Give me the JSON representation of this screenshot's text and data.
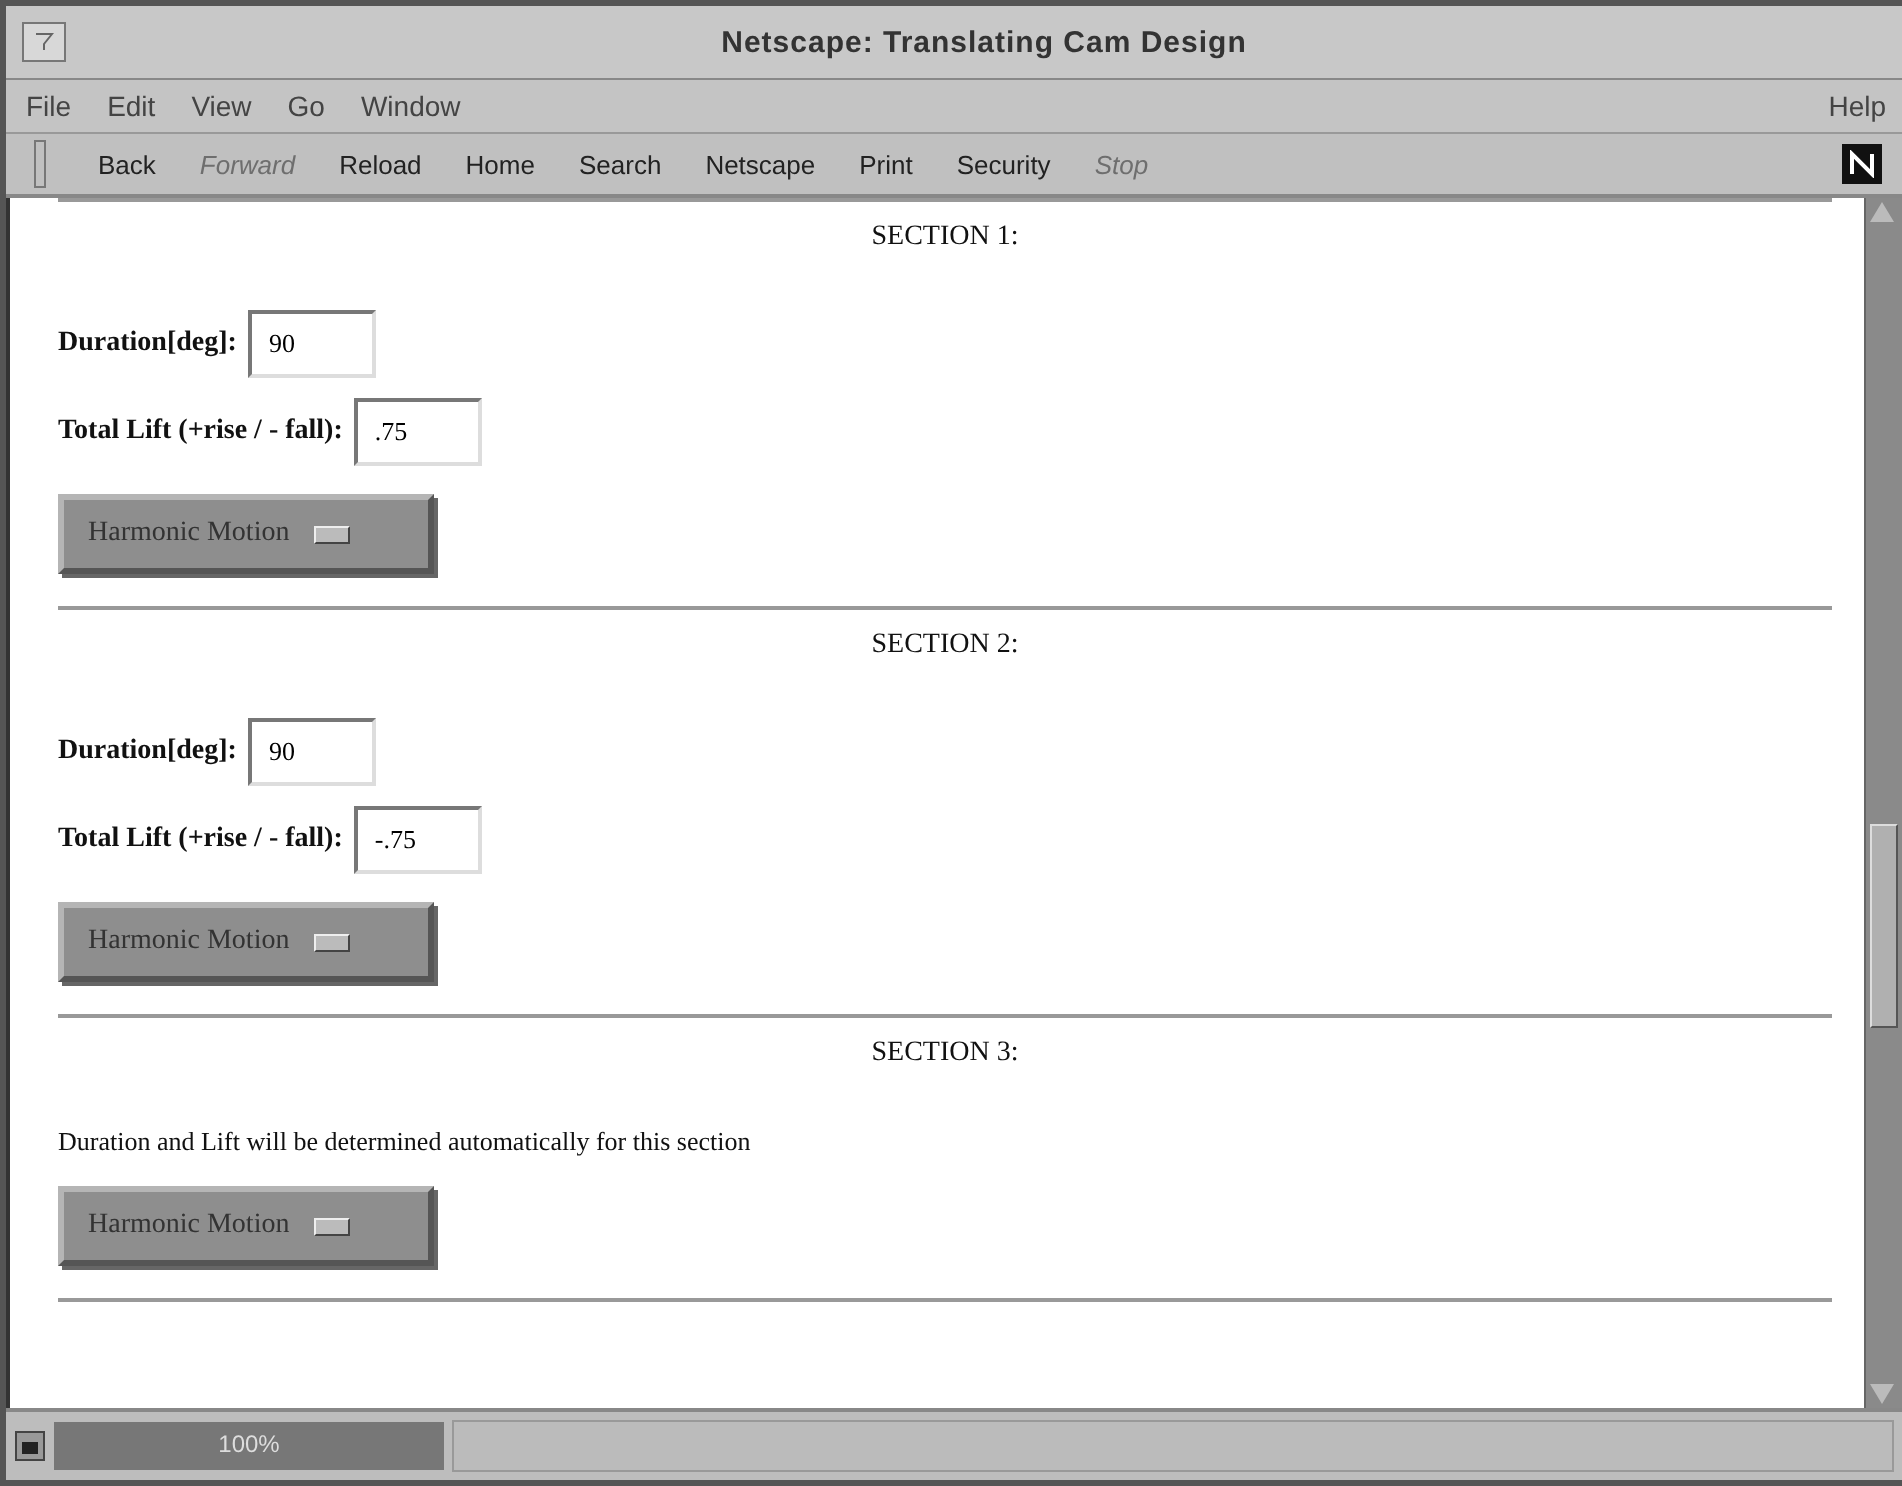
{
  "window": {
    "title": "Netscape: Translating Cam Design"
  },
  "menu": {
    "left": [
      "File",
      "Edit",
      "View",
      "Go",
      "Window"
    ],
    "right": "Help"
  },
  "toolbar": [
    {
      "label": "Back",
      "disabled": false
    },
    {
      "label": "Forward",
      "disabled": true
    },
    {
      "label": "Reload",
      "disabled": false
    },
    {
      "label": "Home",
      "disabled": false
    },
    {
      "label": "Search",
      "disabled": false
    },
    {
      "label": "Netscape",
      "disabled": false
    },
    {
      "label": "Print",
      "disabled": false
    },
    {
      "label": "Security",
      "disabled": false
    },
    {
      "label": "Stop",
      "disabled": true
    }
  ],
  "sections": [
    {
      "kind": "inputs",
      "heading": "SECTION 1:",
      "fields": [
        {
          "label": "Duration[deg]:",
          "value": "90"
        },
        {
          "label": "Total Lift (+rise / - fall):",
          "value": ".75"
        }
      ],
      "option": "Harmonic Motion"
    },
    {
      "kind": "inputs",
      "heading": "SECTION 2:",
      "fields": [
        {
          "label": "Duration[deg]:",
          "value": "90"
        },
        {
          "label": "Total Lift (+rise / - fall):",
          "value": "-.75"
        }
      ],
      "option": "Harmonic Motion"
    },
    {
      "kind": "note",
      "heading": "SECTION 3:",
      "note": "Duration and Lift will be determined automatically for this section",
      "option": "Harmonic Motion"
    }
  ],
  "status_bar": {
    "progress": "100%",
    "level": 1
  }
}
